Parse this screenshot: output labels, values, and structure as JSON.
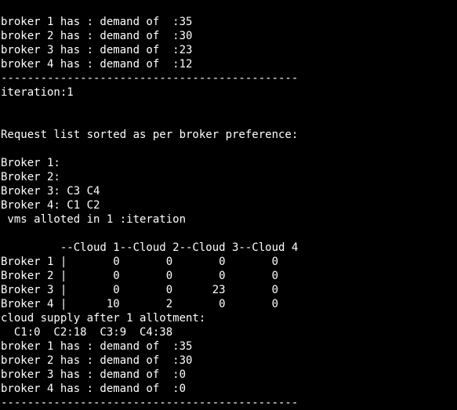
{
  "terminal": {
    "lines": [
      "broker 1 has : demand of  :35",
      "broker 2 has : demand of  :30",
      "broker 3 has : demand of  :23",
      "broker 4 has : demand of  :12",
      "---------------------------------------------",
      "iteration:1",
      "",
      "",
      "Request list sorted as per broker preference:",
      "",
      "Broker 1:",
      "Broker 2:",
      "Broker 3: C3 C4",
      "Broker 4: C1 C2",
      " vms alloted in 1 :iteration",
      "",
      "         --Cloud 1--Cloud 2--Cloud 3--Cloud 4",
      "Broker 1 |       0       0       0       0",
      "Broker 2 |       0       0       0       0",
      "Broker 3 |       0       0      23       0",
      "Broker 4 |      10       2       0       0",
      "cloud supply after 1 allotment:",
      "  C1:0  C2:18  C3:9  C4:38",
      "broker 1 has : demand of  :35",
      "broker 2 has : demand of  :30",
      "broker 3 has : demand of  :0",
      "broker 4 has : demand of  :0",
      "---------------------------------------------"
    ]
  }
}
